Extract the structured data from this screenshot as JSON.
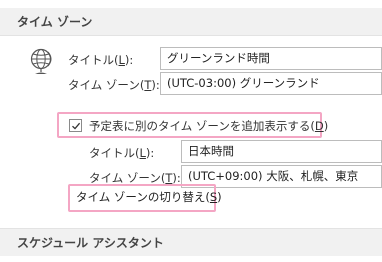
{
  "primary_section": {
    "title": "タイム ゾーン"
  },
  "primary": {
    "title_label": "タイトル(",
    "title_key": "L",
    "title_end": "):",
    "title_value": "グリーンランド時間",
    "tz_label": "タイム ゾーン(",
    "tz_key": "T",
    "tz_end": "):",
    "tz_value": "(UTC-03:00) グリーンランド"
  },
  "secondary_toggle": {
    "label": "予定表に別のタイム ゾーンを追加表示する(",
    "key": "D",
    "end": ")",
    "checked": true
  },
  "secondary": {
    "title_label": "タイトル(",
    "title_key": "L",
    "title_end": "):",
    "title_value": "日本時間",
    "tz_label": "タイム ゾーン(",
    "tz_key": "T",
    "tz_end": "):",
    "tz_value": "(UTC+09:00) 大阪、札幌、東京"
  },
  "swap_button": {
    "label": "タイム ゾーンの切り替え(",
    "key": "S",
    "end": ")"
  },
  "next_section": {
    "title": "スケジュール アシスタント"
  },
  "colors": {
    "highlight": "#f4a6c4",
    "header_bg": "#f1f1f1",
    "border": "#bcbcbc"
  },
  "icons": {
    "section_icon": "globe-icon",
    "check_icon": "checkmark-icon"
  }
}
